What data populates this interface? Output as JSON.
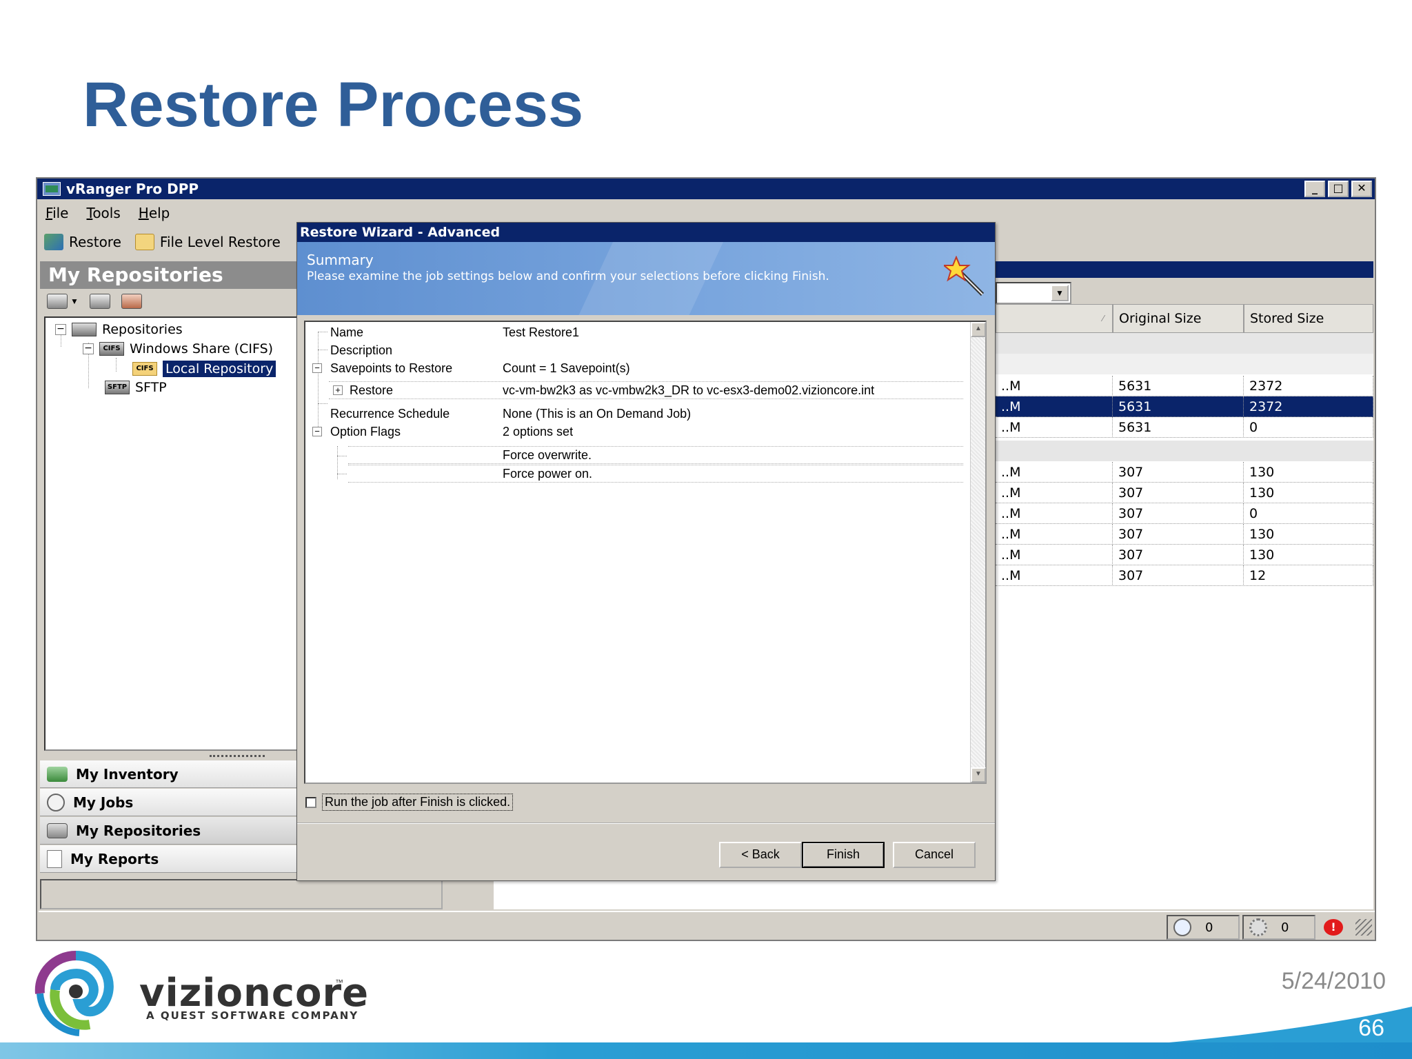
{
  "slide": {
    "title": "Restore Process",
    "date": "5/24/2010",
    "page_number": "66",
    "brand": "vizioncore",
    "brand_tm": "™",
    "brand_sub": "A QUEST SOFTWARE COMPANY"
  },
  "app": {
    "title": "vRanger Pro DPP",
    "window_buttons": {
      "minimize": "_",
      "maximize": "□",
      "close": "✕"
    },
    "menu": [
      "File",
      "Tools",
      "Help"
    ],
    "toolbar": {
      "restore": "Restore",
      "file_level_restore": "File Level Restore"
    },
    "pane_header": "My Repositories",
    "tree": {
      "root": "Repositories",
      "cifs": "Windows Share (CIFS)",
      "cifs_badge": "CIFS",
      "local_repo": "Local Repository",
      "sftp": "SFTP",
      "sftp_badge": "SFTP"
    },
    "nav": {
      "inventory": "My Inventory",
      "jobs": "My Jobs",
      "repositories": "My Repositories",
      "reports": "My Reports"
    },
    "grid": {
      "columns": [
        "Original Size",
        "Stored Size"
      ],
      "rows": [
        {
          "a": "..M",
          "original": "5631",
          "stored": "2372",
          "selected": false
        },
        {
          "a": "..M",
          "original": "5631",
          "stored": "2372",
          "selected": true
        },
        {
          "a": "..M",
          "original": "5631",
          "stored": "0",
          "selected": false
        },
        {
          "a": "..M",
          "original": "307",
          "stored": "130",
          "selected": false
        },
        {
          "a": "..M",
          "original": "307",
          "stored": "130",
          "selected": false
        },
        {
          "a": "..M",
          "original": "307",
          "stored": "0",
          "selected": false
        },
        {
          "a": "..M",
          "original": "307",
          "stored": "130",
          "selected": false
        },
        {
          "a": "..M",
          "original": "307",
          "stored": "130",
          "selected": false
        },
        {
          "a": "..M",
          "original": "307",
          "stored": "12",
          "selected": false
        }
      ]
    },
    "status": {
      "clock_count": "0",
      "task_count": "0",
      "alert": "!"
    }
  },
  "wizard": {
    "title": "Restore Wizard - Advanced",
    "banner_title": "Summary",
    "banner_text": "Please examine the job settings below and confirm your selections before clicking Finish.",
    "summary": {
      "name_key": "Name",
      "name_val": "Test Restore1",
      "desc_key": "Description",
      "savepoints_key": "Savepoints to Restore",
      "savepoints_val": "Count = 1 Savepoint(s)",
      "restore_key": "Restore",
      "restore_val": "vc-vm-bw2k3  as  vc-vmbw2k3_DR  to  vc-esx3-demo02.vizioncore.int",
      "schedule_key": "Recurrence Schedule",
      "schedule_val": "None (This is an On Demand Job)",
      "flags_key": "Option Flags",
      "flags_val": "2 options set",
      "flag1": "Force overwrite.",
      "flag2": "Force power on."
    },
    "run_after_finish": "Run the job after Finish is clicked.",
    "run_checked": false,
    "buttons": {
      "back": "< Back",
      "finish": "Finish",
      "cancel": "Cancel"
    }
  },
  "colors": {
    "title_blue": "#2f5e98",
    "titlebar": "#0a246a",
    "selection": "#0a246a",
    "stripe": "#2a9ed4"
  }
}
